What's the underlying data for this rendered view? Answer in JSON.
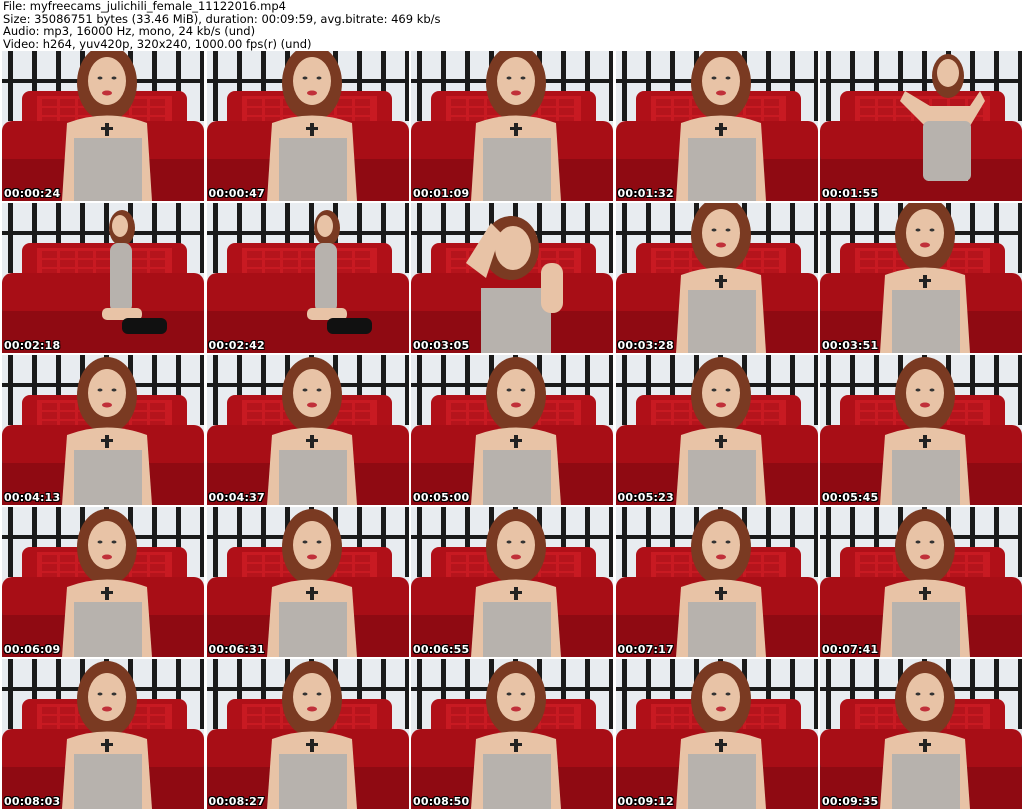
{
  "header": {
    "file": "File: myfreecams_julichili_female_11122016.mp4",
    "size": "Size: 35086751 bytes (33.46 MiB), duration: 00:09:59, avg.bitrate: 469 kb/s",
    "audio": "Audio: mp3, 16000 Hz, mono, 24 kb/s (und)",
    "video": "Video: h264, yuv420p, 320x240, 1000.00 fps(r) (und)"
  },
  "frames": [
    {
      "time": "00:00:24",
      "scene": "closeup"
    },
    {
      "time": "00:00:47",
      "scene": "closeup"
    },
    {
      "time": "00:01:09",
      "scene": "closeup"
    },
    {
      "time": "00:01:32",
      "scene": "closeup"
    },
    {
      "time": "00:01:55",
      "scene": "standing"
    },
    {
      "time": "00:02:18",
      "scene": "kneeling"
    },
    {
      "time": "00:02:42",
      "scene": "kneeling"
    },
    {
      "time": "00:03:05",
      "scene": "waving"
    },
    {
      "time": "00:03:28",
      "scene": "closeup"
    },
    {
      "time": "00:03:51",
      "scene": "closeup"
    },
    {
      "time": "00:04:13",
      "scene": "seated"
    },
    {
      "time": "00:04:37",
      "scene": "seated"
    },
    {
      "time": "00:05:00",
      "scene": "seated"
    },
    {
      "time": "00:05:23",
      "scene": "seated"
    },
    {
      "time": "00:05:45",
      "scene": "seated"
    },
    {
      "time": "00:06:09",
      "scene": "seated"
    },
    {
      "time": "00:06:31",
      "scene": "seated"
    },
    {
      "time": "00:06:55",
      "scene": "seated"
    },
    {
      "time": "00:07:17",
      "scene": "seated"
    },
    {
      "time": "00:07:41",
      "scene": "seated"
    },
    {
      "time": "00:08:03",
      "scene": "seated"
    },
    {
      "time": "00:08:27",
      "scene": "seated"
    },
    {
      "time": "00:08:50",
      "scene": "seated"
    },
    {
      "time": "00:09:12",
      "scene": "seated"
    },
    {
      "time": "00:09:35",
      "scene": "seated"
    }
  ]
}
